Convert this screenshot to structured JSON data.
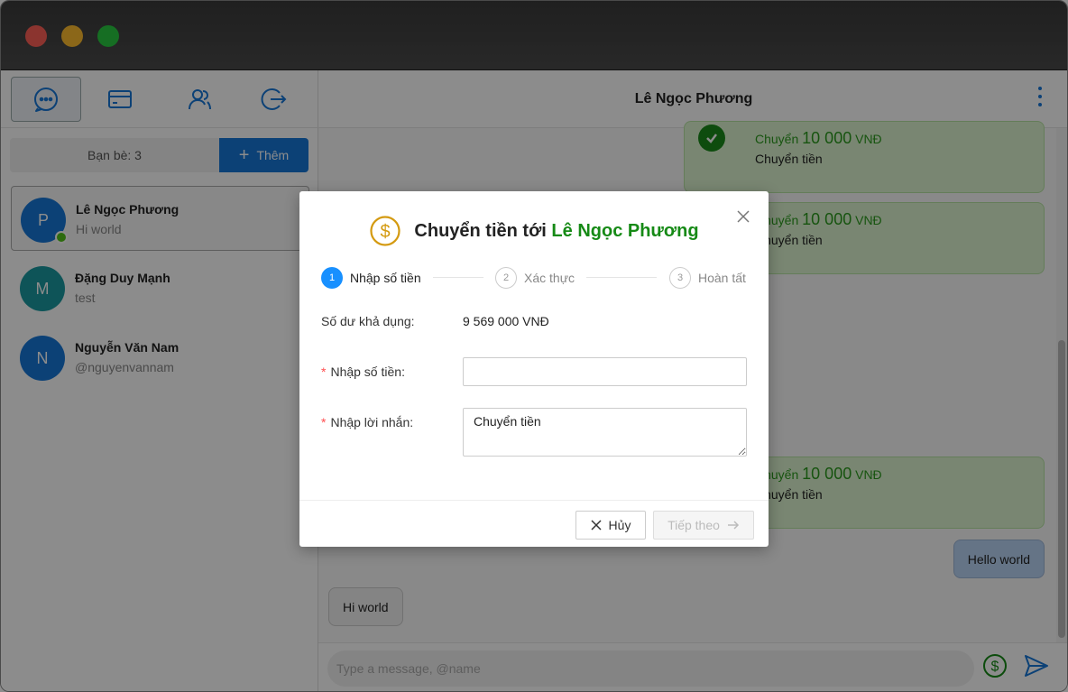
{
  "sidebar": {
    "friend_count": "Bạn bè: 3",
    "add_label": "Thêm",
    "contacts": [
      {
        "initial": "P",
        "name": "Lê Ngọc Phương",
        "preview": "Hi world",
        "color": "#1677d8",
        "online": true
      },
      {
        "initial": "M",
        "name": "Đặng Duy Mạnh",
        "preview": "test",
        "color": "#1a9aa0"
      },
      {
        "initial": "N",
        "name": "Nguyễn Văn Nam",
        "preview": "@nguyenvannam",
        "color": "#1677d8"
      }
    ]
  },
  "chat": {
    "title": "Lê Ngọc Phương",
    "transfers": [
      {
        "prefix": "Chuyển",
        "amount": "10 000",
        "currency": "VNĐ",
        "note": "Chuyển tiền"
      },
      {
        "prefix": "Chuyển",
        "amount": "10 000",
        "currency": "VNĐ",
        "note": "Chuyển tiền"
      },
      {
        "prefix": "Chuyển",
        "amount": "10 000",
        "currency": "VNĐ",
        "note": "Chuyển tiền"
      }
    ],
    "outgoing": "Hello world",
    "incoming": "Hi world",
    "input_placeholder": "Type a message, @name"
  },
  "modal": {
    "title_prefix": "Chuyển tiền tới",
    "title_name": "Lê Ngọc Phương",
    "steps": [
      {
        "num": "1",
        "label": "Nhập số tiền"
      },
      {
        "num": "2",
        "label": "Xác thực"
      },
      {
        "num": "3",
        "label": "Hoàn tất"
      }
    ],
    "balance_label": "Số dư khả dụng",
    "balance_value": "9 569 000 VNĐ",
    "amount_label": "Nhập số tiền",
    "amount_value": "",
    "message_label": "Nhập lời nhắn",
    "message_value": "Chuyển tiền",
    "cancel_label": "Hủy",
    "next_label": "Tiếp theo"
  },
  "colors": {
    "accent": "#1677d8",
    "success": "#168a16",
    "coin": "#d49a10"
  }
}
